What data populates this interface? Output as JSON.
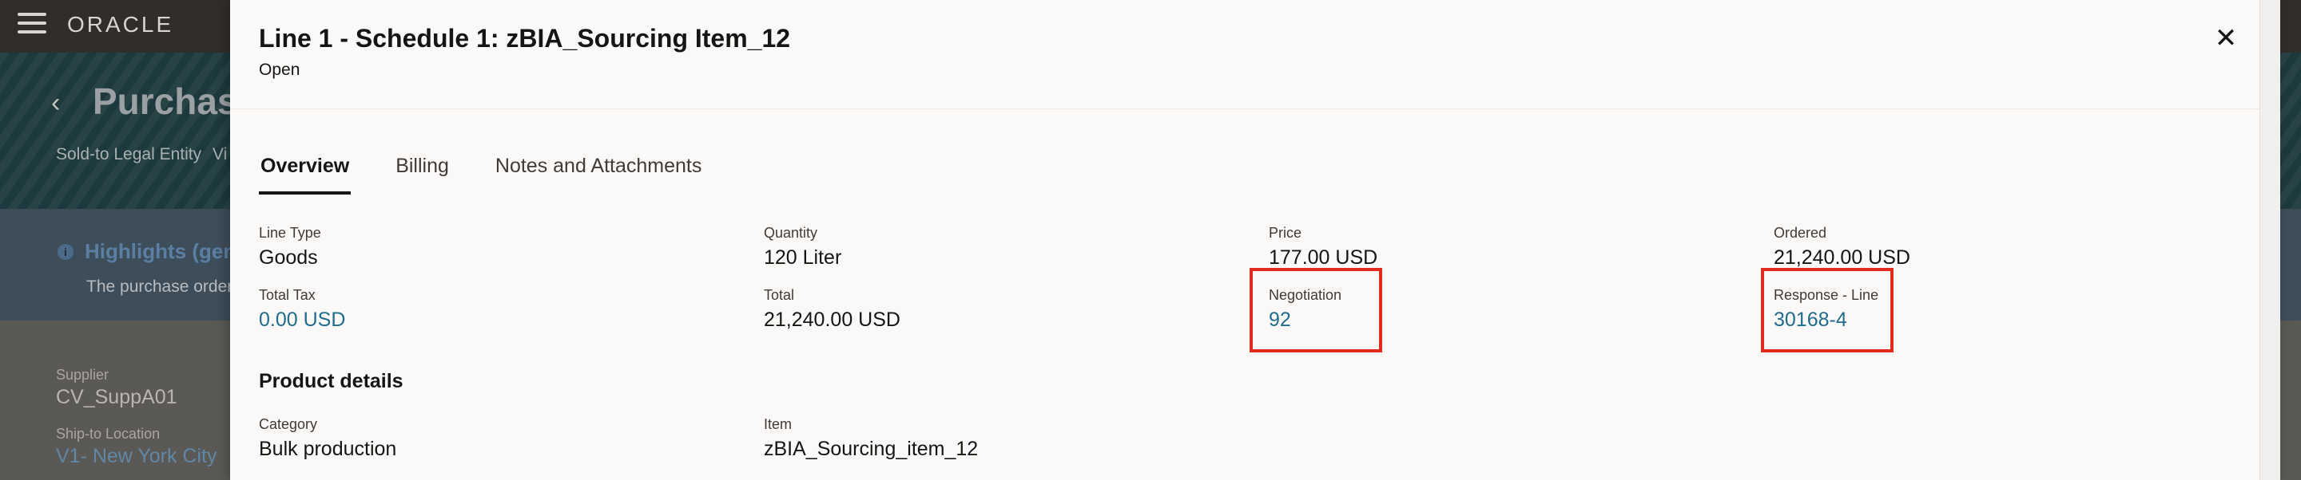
{
  "app": {
    "logo_text": "ORACLE"
  },
  "background": {
    "page_title": "Purchase",
    "sold_to_label": "Sold-to Legal Entity",
    "sold_to_value": "Vi",
    "highlights_title": "Highlights (gen",
    "highlights_text": "The purchase order",
    "supplier_label": "Supplier",
    "supplier_value": "CV_SuppA01",
    "ship_to_label": "Ship-to Location",
    "ship_to_value": "V1- New York City"
  },
  "drawer": {
    "title": "Line 1 - Schedule 1: zBIA_Sourcing Item_12",
    "status": "Open",
    "close_icon": "close-icon",
    "tabs": [
      {
        "label": "Overview",
        "active": true
      },
      {
        "label": "Billing",
        "active": false
      },
      {
        "label": "Notes and Attachments",
        "active": false
      }
    ],
    "fields": {
      "line_type": {
        "label": "Line Type",
        "value": "Goods"
      },
      "quantity": {
        "label": "Quantity",
        "value": "120 Liter"
      },
      "price": {
        "label": "Price",
        "value": "177.00 USD"
      },
      "ordered": {
        "label": "Ordered",
        "value": "21,240.00 USD"
      },
      "total_tax": {
        "label": "Total Tax",
        "value": "0.00 USD"
      },
      "total": {
        "label": "Total",
        "value": "21,240.00 USD"
      },
      "negotiation": {
        "label": "Negotiation",
        "value": "92"
      },
      "response_line": {
        "label": "Response - Line",
        "value": "30168-4"
      }
    },
    "product_details": {
      "title": "Product details",
      "category": {
        "label": "Category",
        "value": "Bulk production"
      },
      "item": {
        "label": "Item",
        "value": "zBIA_Sourcing_item_12"
      }
    }
  },
  "colors": {
    "link": "#1f6c8d",
    "highlight_box": "#e02b1f",
    "topbar": "#312d2a"
  }
}
